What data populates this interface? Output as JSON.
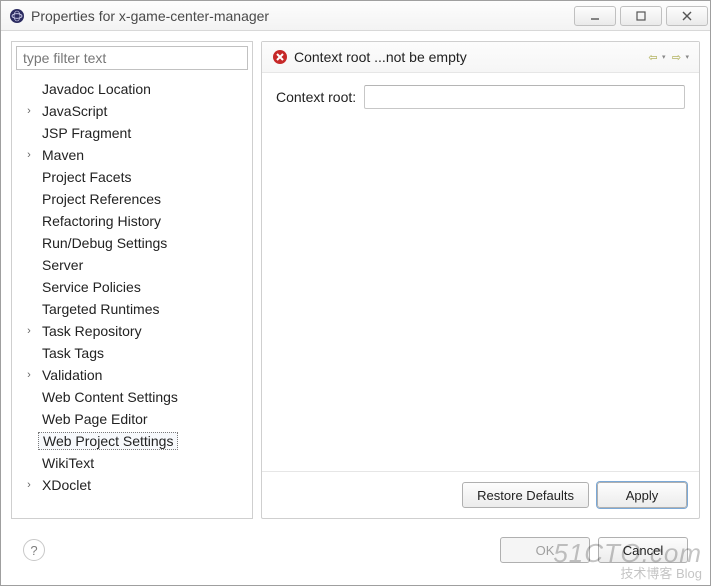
{
  "window": {
    "title": "Properties for x-game-center-manager"
  },
  "sidebar": {
    "filter_placeholder": "type filter text",
    "items": [
      {
        "label": "Javadoc Location",
        "expandable": false
      },
      {
        "label": "JavaScript",
        "expandable": true
      },
      {
        "label": "JSP Fragment",
        "expandable": false
      },
      {
        "label": "Maven",
        "expandable": true
      },
      {
        "label": "Project Facets",
        "expandable": false
      },
      {
        "label": "Project References",
        "expandable": false
      },
      {
        "label": "Refactoring History",
        "expandable": false
      },
      {
        "label": "Run/Debug Settings",
        "expandable": false
      },
      {
        "label": "Server",
        "expandable": false
      },
      {
        "label": "Service Policies",
        "expandable": false
      },
      {
        "label": "Targeted Runtimes",
        "expandable": false
      },
      {
        "label": "Task Repository",
        "expandable": true
      },
      {
        "label": "Task Tags",
        "expandable": false
      },
      {
        "label": "Validation",
        "expandable": true
      },
      {
        "label": "Web Content Settings",
        "expandable": false
      },
      {
        "label": "Web Page Editor",
        "expandable": false
      },
      {
        "label": "Web Project Settings",
        "expandable": false,
        "selected": true
      },
      {
        "label": "WikiText",
        "expandable": false
      },
      {
        "label": "XDoclet",
        "expandable": true
      }
    ]
  },
  "main": {
    "error_message": "Context root ...not be empty",
    "context_root_label": "Context root:",
    "context_root_value": ""
  },
  "buttons": {
    "restore_defaults": "Restore Defaults",
    "apply": "Apply",
    "ok": "OK",
    "cancel": "Cancel"
  },
  "watermark": {
    "line1": "51CTO.com",
    "line2": "技术博客  Blog"
  }
}
